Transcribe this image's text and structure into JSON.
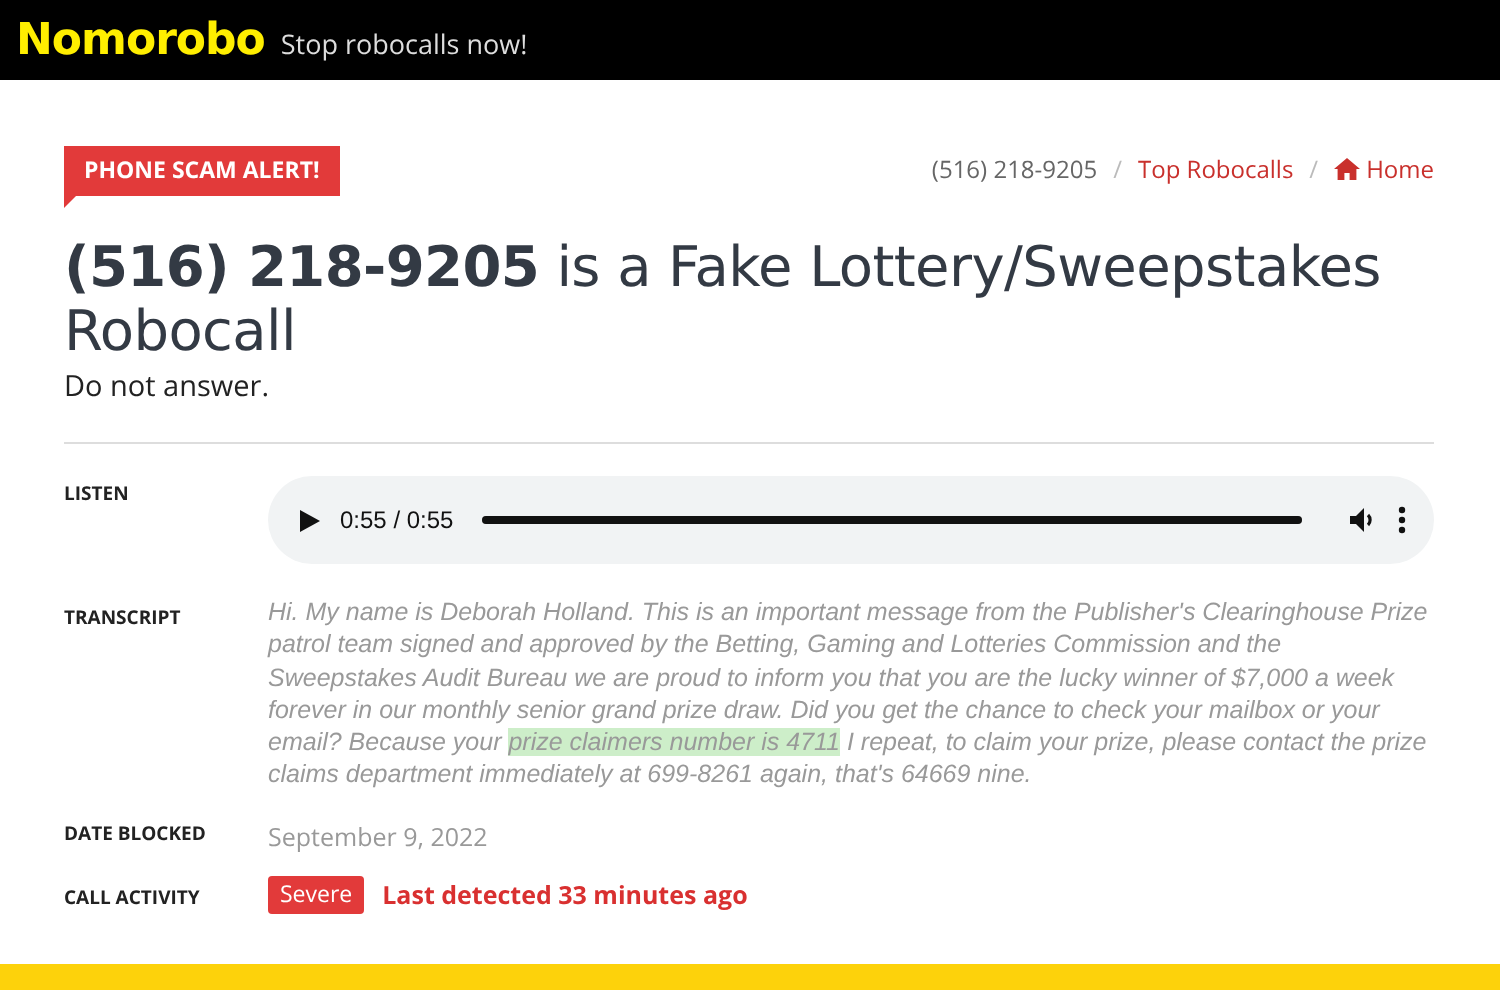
{
  "header": {
    "logo": "Nomorobo",
    "tagline": "Stop robocalls now!"
  },
  "alert_badge": "PHONE SCAM ALERT!",
  "breadcrumbs": [
    {
      "label": "(516) 218-9205",
      "kind": "current"
    },
    {
      "separator": "/",
      "label": "Top Robocalls",
      "kind": "link"
    },
    {
      "separator": "/",
      "label": "Home",
      "kind": "home"
    }
  ],
  "title": {
    "number": "(516) 218-9205",
    "rest": "is a Fake Lottery/Sweepstakes Robocall"
  },
  "subtitle": "Do not answer.",
  "details": [
    {
      "label": "LISTEN",
      "kind": "audio",
      "time": "0:55 / 0:55",
      "level": 1
    },
    {
      "label": "TRANSCRIPT",
      "kind": "transcript",
      "parts": [
        {
          "text": "Hi. My name is Deborah Holland. This is an important message from the Publisher's Clearinghouse Prize patrol team signed and approved by the Betting, Gaming and Lotteries Commission and the Sweepstakes Audit Bureau we are proud to inform you that you are the lucky winner of $7,000 a week forever in our monthly senior grand prize draw. Did you get the chance to check your mailbox or your email? Because your ",
          "highlight": false
        },
        {
          "text": "prize claimers number is 4711",
          "highlight": true
        },
        {
          "text": " I repeat, to claim your prize, please contact the prize claims department immediately at 699-8261 again, that's 64669 nine.",
          "highlight": false
        }
      ]
    },
    {
      "label": "DATE BLOCKED",
      "kind": "text",
      "value": "September 9, 2022"
    },
    {
      "label": "CALL ACTIVITY",
      "kind": "activity",
      "badge": "Severe",
      "value": "Last detected 33 minutes ago"
    }
  ]
}
